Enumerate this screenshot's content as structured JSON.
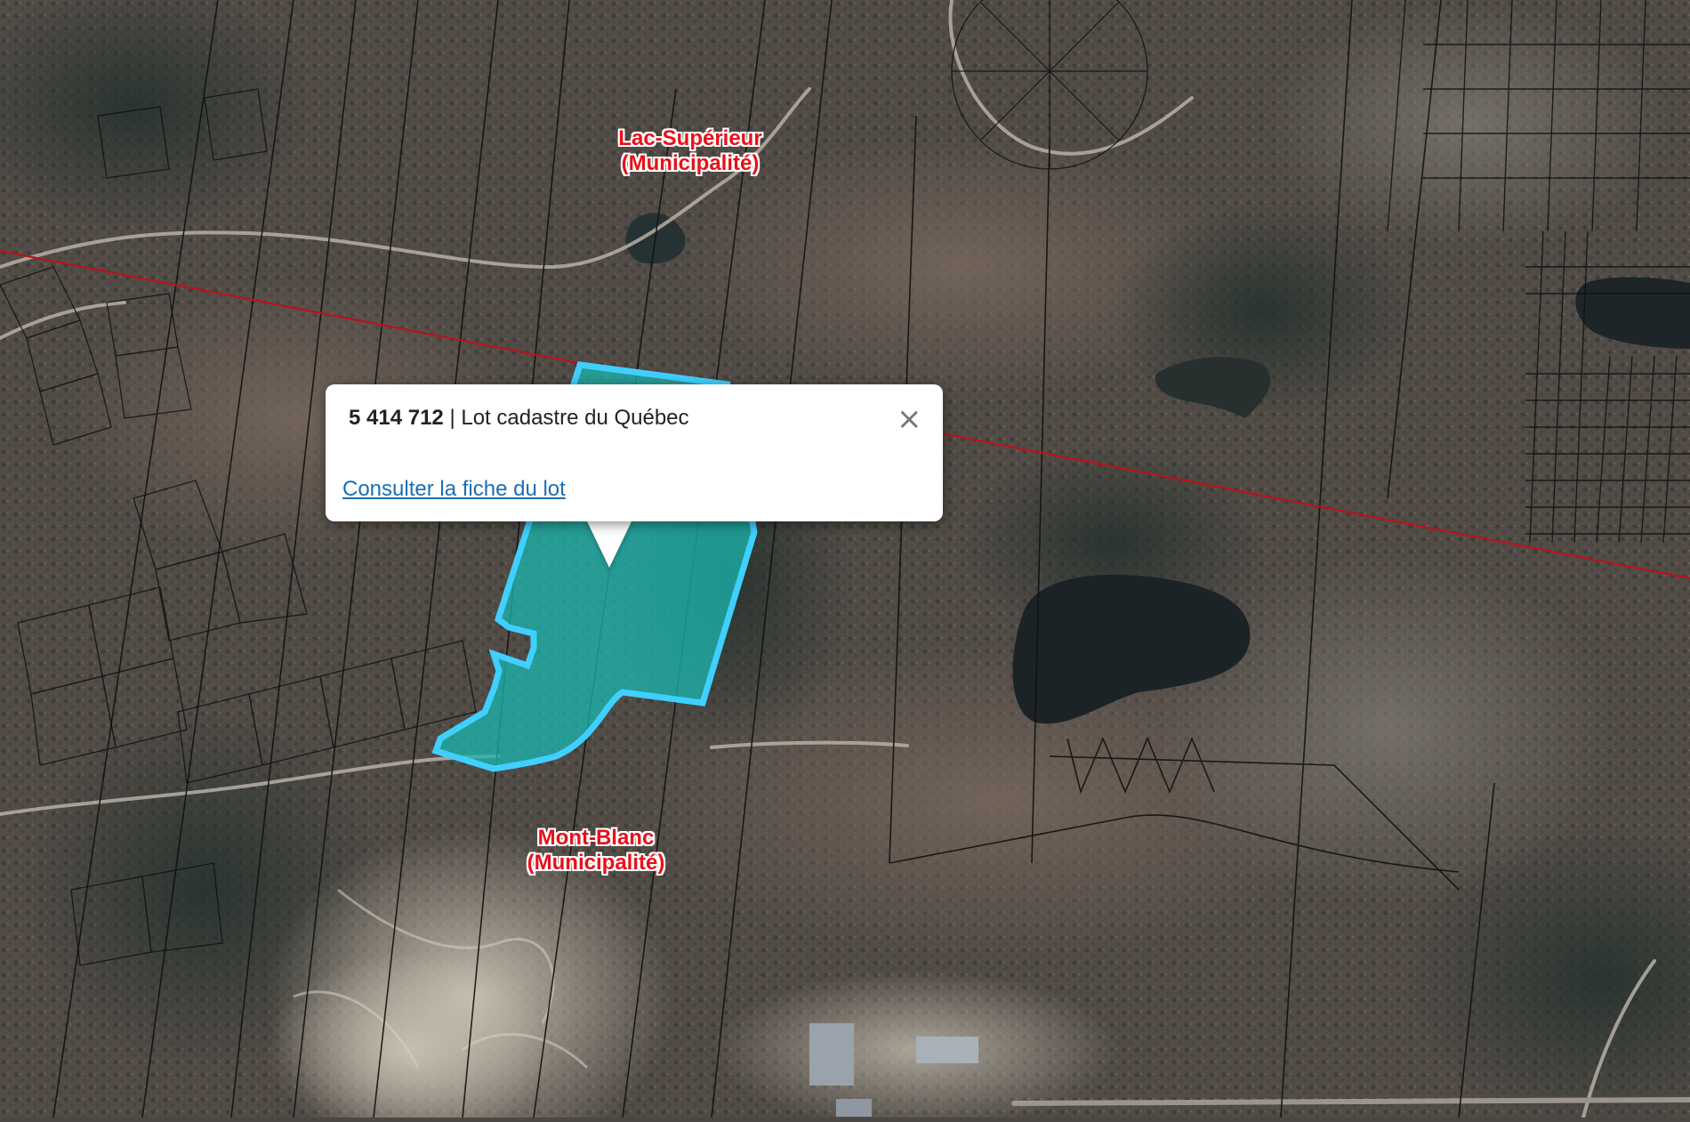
{
  "map": {
    "basemap": "aerial-imagery",
    "colors": {
      "lot_fill": "#19b7b0",
      "lot_outline": "#3fd0ff",
      "boundary_line": "#c0141a",
      "cadastre_lines": "#111111",
      "label_text": "#e8101a"
    }
  },
  "labels": {
    "municipality_1": {
      "name": "Lac-Supérieur",
      "type": "(Municipalité)"
    },
    "municipality_2": {
      "name": "Mont-Blanc",
      "type": "(Municipalité)"
    }
  },
  "popup": {
    "lot_number": "5 414 712",
    "separator": " | ",
    "lot_type": "Lot cadastre du Québec",
    "link_text": "Consulter la fiche du lot",
    "close_icon": "close-icon",
    "close_glyph": "×"
  }
}
